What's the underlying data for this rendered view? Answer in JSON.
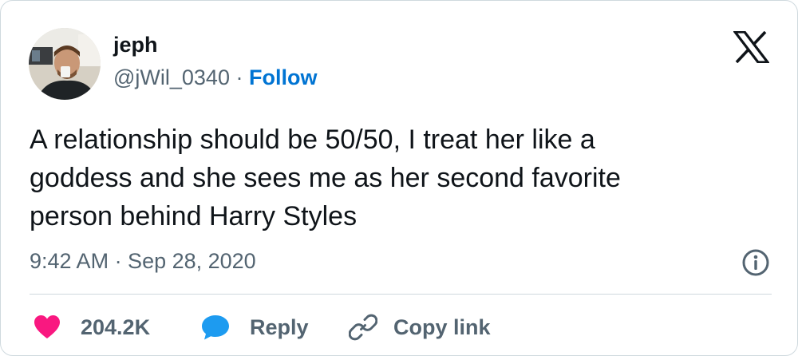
{
  "user": {
    "display_name": "jeph",
    "handle": "@jWil_0340",
    "separator": "·",
    "follow_label": "Follow"
  },
  "tweet": {
    "text": "A relationship should be 50/50, I treat her like a\ngoddess and she sees me as her second favorite\nperson behind Harry Styles",
    "timestamp": "9:42 AM · Sep 28, 2020"
  },
  "actions": {
    "like_count": "204.2K",
    "reply_label": "Reply",
    "copy_link_label": "Copy link"
  },
  "icons": {
    "brand": "x-logo",
    "info": "info-icon",
    "like": "heart-icon",
    "reply": "speech-bubble-icon",
    "copy": "link-icon"
  },
  "colors": {
    "text_primary": "#0f1419",
    "text_secondary": "#536471",
    "follow_link": "#0074d3",
    "like_heart": "#f91880",
    "reply_bubble": "#1d9bf0",
    "border": "#cfd9de"
  }
}
